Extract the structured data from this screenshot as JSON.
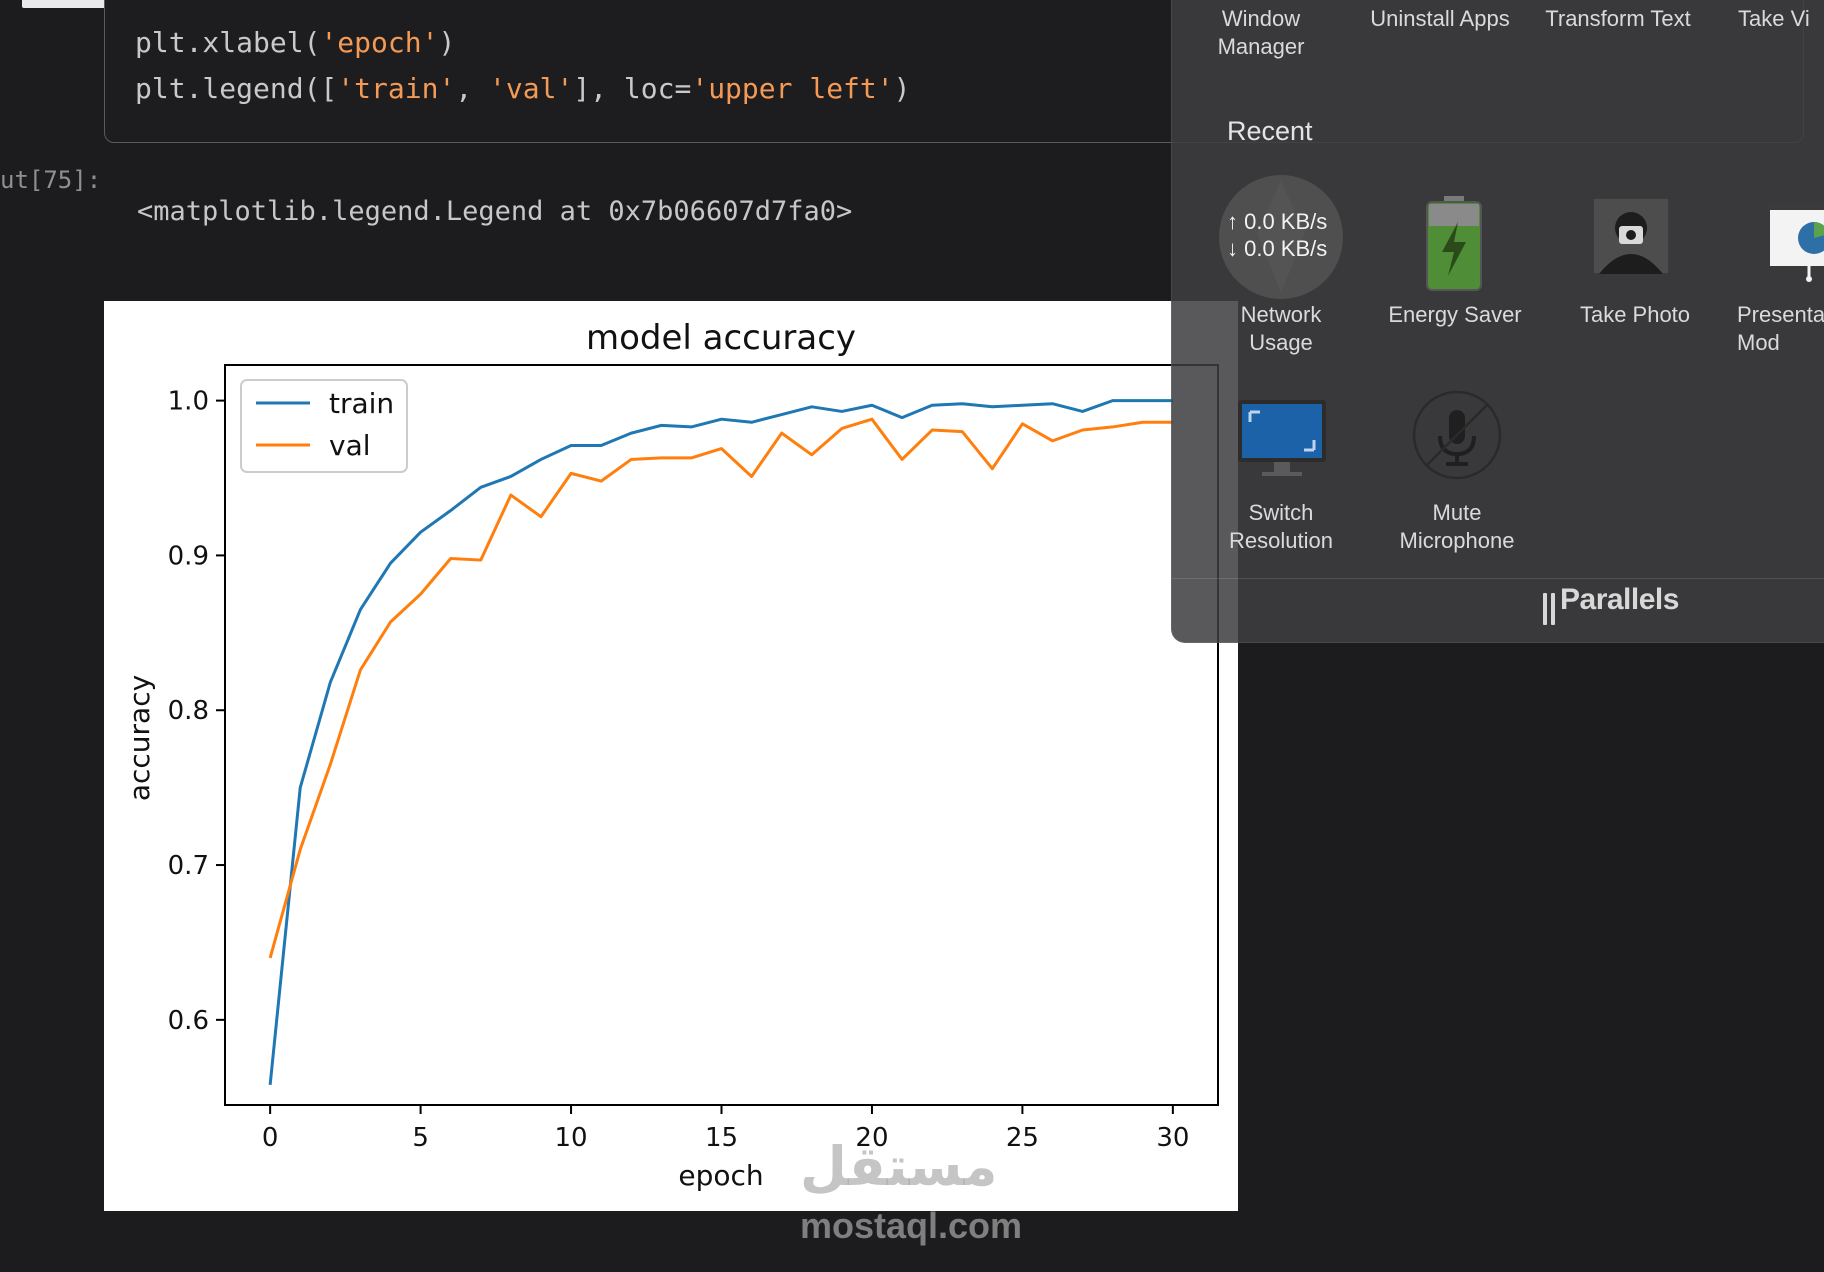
{
  "code": {
    "line1": [
      "plt.xlabel(",
      "'epoch'",
      ")"
    ],
    "line2": [
      "plt.legend([",
      "'train'",
      ", ",
      "'val'",
      "], loc=",
      "'upper left'",
      ")"
    ]
  },
  "output": {
    "prompt": "ut[75]:",
    "text": "<matplotlib.legend.Legend at 0x7b06607d7fa0>"
  },
  "chart_data": {
    "type": "line",
    "title": "model accuracy",
    "xlabel": "epoch",
    "ylabel": "accuracy",
    "xlim": [
      -1.5,
      31.5
    ],
    "ylim": [
      0.545,
      1.023
    ],
    "xticks": [
      0,
      5,
      10,
      15,
      20,
      25,
      30
    ],
    "yticks": [
      0.6,
      0.7,
      0.8,
      0.9,
      1.0
    ],
    "ytick_labels": [
      "0.6",
      "0.7",
      "0.8",
      "0.9",
      "1.0"
    ],
    "legend_position": "upper left",
    "x": [
      0,
      1,
      2,
      3,
      4,
      5,
      6,
      7,
      8,
      9,
      10,
      11,
      12,
      13,
      14,
      15,
      16,
      17,
      18,
      19,
      20,
      21,
      22,
      23,
      24,
      25,
      26,
      27,
      28,
      29,
      30
    ],
    "series": [
      {
        "name": "train",
        "color": "#1f77b4",
        "values": [
          0.558,
          0.75,
          0.818,
          0.865,
          0.895,
          0.915,
          0.929,
          0.944,
          0.951,
          0.962,
          0.971,
          0.971,
          0.979,
          0.984,
          0.983,
          0.988,
          0.986,
          0.991,
          0.996,
          0.993,
          0.997,
          0.989,
          0.997,
          0.998,
          0.996,
          0.997,
          0.998,
          0.993,
          1.0,
          1.0,
          1.0
        ]
      },
      {
        "name": "val",
        "color": "#ff7f0e",
        "values": [
          0.64,
          0.71,
          0.765,
          0.826,
          0.857,
          0.875,
          0.898,
          0.897,
          0.939,
          0.925,
          0.953,
          0.948,
          0.962,
          0.963,
          0.963,
          0.969,
          0.951,
          0.979,
          0.965,
          0.982,
          0.988,
          0.962,
          0.981,
          0.98,
          0.956,
          0.985,
          0.974,
          0.981,
          0.983,
          0.986,
          0.986
        ]
      }
    ]
  },
  "panel": {
    "top_items": [
      "Window\nManager",
      "Uninstall Apps",
      "Transform Text",
      "Take Vi"
    ],
    "recent_heading": "Recent",
    "network_up": "↑ 0.0 KB/s",
    "network_down": "↓ 0.0 KB/s",
    "items": [
      {
        "label": "Network\nUsage",
        "icon": "network-gauge-icon"
      },
      {
        "label": "Energy Saver",
        "icon": "battery-bolt-icon"
      },
      {
        "label": "Take Photo",
        "icon": "camera-icon"
      },
      {
        "label": "Presenta\nMod",
        "icon": "presentation-icon"
      },
      {
        "label": "Switch\nResolution",
        "icon": "monitor-icon"
      },
      {
        "label": "Mute\nMicrophone",
        "icon": "microphone-muted-icon"
      }
    ],
    "brand": "Parallels"
  },
  "watermark": {
    "arabic": "مستقل",
    "url": "mostaql.com"
  }
}
